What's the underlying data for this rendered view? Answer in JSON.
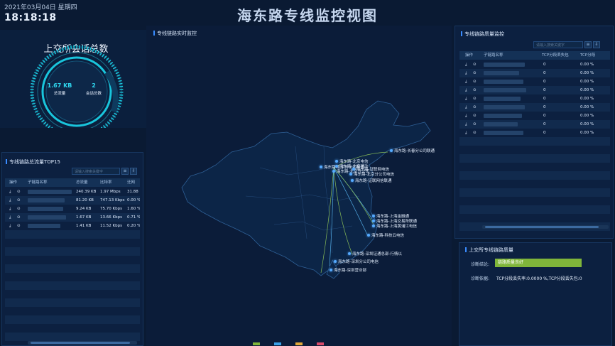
{
  "header": {
    "date": "2021年03月04日 星期四",
    "time": "18:18:18",
    "title": "海东路专线监控视图"
  },
  "sessions": {
    "title": "上交所会话总数",
    "traffic_value": "1.67 KB",
    "traffic_label": "总流量",
    "count_value": "2",
    "count_label": "会话总数"
  },
  "top15": {
    "title": "专线链路总流量TOP15",
    "search_placeholder": "请输入搜索关键字",
    "columns": [
      "操作",
      "子链路名称",
      "总流量",
      "比特率",
      "迁网"
    ],
    "rows": [
      [
        "240.39 KB",
        "1.97 Mbps",
        "31.88"
      ],
      [
        "81.20 KB",
        "747.13 Kbps",
        "0.00 %"
      ],
      [
        "9.24 KB",
        "75.70 Kbps",
        "1.60 %"
      ],
      [
        "1.67 KB",
        "13.66 Kbps",
        "0.71 %"
      ],
      [
        "1.41 KB",
        "11.52 Kbps",
        "0.20 %"
      ]
    ]
  },
  "map": {
    "title": "专线链路实时监控",
    "cities": [
      "海东路-长春分公司联通",
      "海东路-北京电信",
      "海东路-北京移动",
      "海东路-北京分公司",
      "海东路-北京分公司联通",
      "海东路-证联网电信",
      "海东路-北京分公司电信",
      "海东路-证联网信联通",
      "海东路-上海金融通",
      "海东路-上海交易所联通",
      "海东路-上海黄浦江电信",
      "海东路-科技云电信",
      "海东路-深圳证通总部-行情以",
      "海东路-深圳分公司电信",
      "海东路-深圳营业部"
    ],
    "legend": [
      "",
      "",
      "",
      "",
      ""
    ]
  },
  "quality": {
    "title": "专线链路质量监控",
    "search_placeholder": "请输入搜索关键字",
    "columns": [
      "操作",
      "子链路名称",
      "TCP分段丢失包",
      "TCP分段"
    ],
    "rows": [
      [
        "0",
        "0.00 %"
      ],
      [
        "0",
        "0.00 %"
      ],
      [
        "0",
        "0.00 %"
      ],
      [
        "0",
        "0.00 %"
      ],
      [
        "0",
        "0.00 %"
      ],
      [
        "0",
        "0.00 %"
      ],
      [
        "0",
        "0.00 %"
      ],
      [
        "0",
        "0.00 %"
      ],
      [
        "0",
        "0.00 %"
      ]
    ]
  },
  "diagnosis": {
    "title": "上交所专线链路质量",
    "conclusion_label": "诊断结论:",
    "conclusion_value": "链路质量良好",
    "basis_label": "诊断依据:",
    "basis_value": "TCP分段丢失率:0.0000 %,TCP分段丢失包:0"
  },
  "colors": {
    "accent": "#3a8cff",
    "gauge": "#19c5dc",
    "good": "#7fb53a",
    "bg": "#0a1a33"
  }
}
